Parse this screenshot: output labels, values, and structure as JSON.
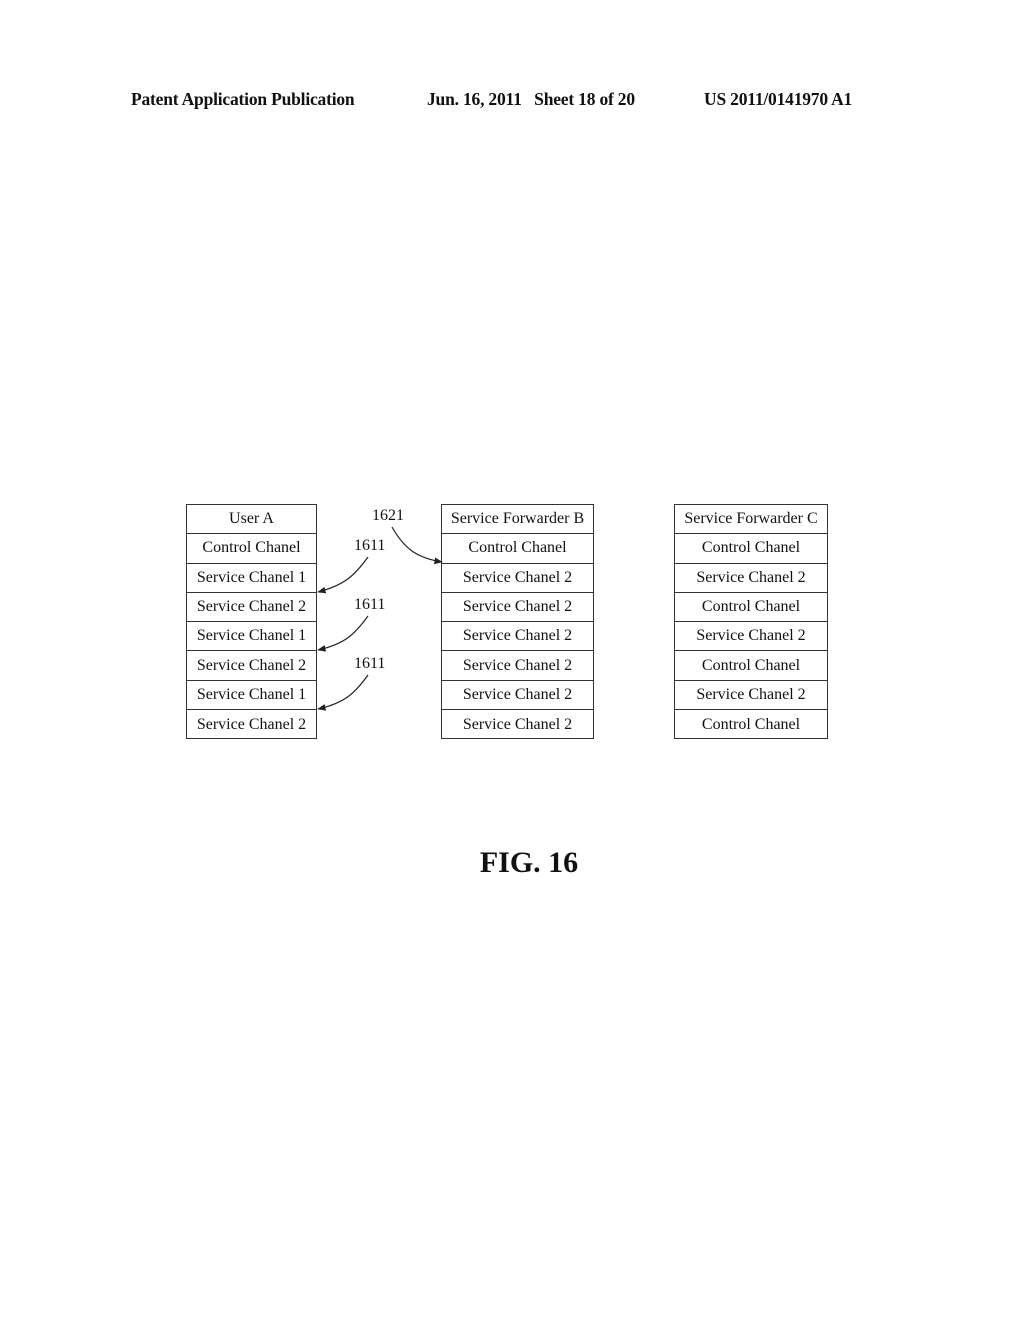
{
  "header": {
    "left": "Patent Application Publication",
    "date_sheet": "Jun. 16, 2011   Sheet 18 of 20",
    "number": "US 2011/0141970 A1"
  },
  "columns": [
    {
      "title": "User A",
      "cells": [
        "Control Chanel",
        "Service Chanel 1",
        "Service Chanel 2",
        "Service Chanel 1",
        "Service Chanel 2",
        "Service Chanel 1",
        "Service Chanel 2"
      ]
    },
    {
      "title": "Service Forwarder B",
      "cells": [
        "Control Chanel",
        "Service Chanel 2",
        "Service Chanel 2",
        "Service Chanel 2",
        "Service Chanel 2",
        "Service Chanel 2",
        "Service Chanel 2"
      ]
    },
    {
      "title": "Service Forwarder C",
      "cells": [
        "Control Chanel",
        "Service Chanel 2",
        "Control Chanel",
        "Service Chanel 2",
        "Control Chanel",
        "Service Chanel 2",
        "Control Chanel"
      ]
    }
  ],
  "references": {
    "r1621": "1621",
    "r1611a": "1611",
    "r1611b": "1611",
    "r1611c": "1611"
  },
  "figure_label": "FIG. 16"
}
